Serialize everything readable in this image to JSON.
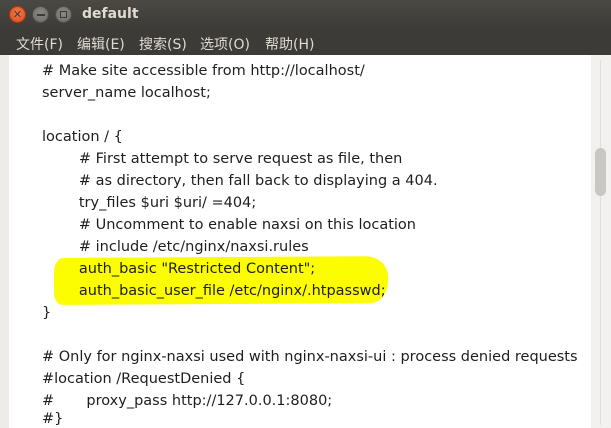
{
  "window": {
    "title": "default"
  },
  "menu": {
    "items": [
      "文件(F)",
      "编辑(E)",
      "搜索(S)",
      "选项(O)",
      "帮助(H)"
    ]
  },
  "editor": {
    "lines": [
      "# Make site accessible from http://localhost/",
      "server_name localhost;",
      "",
      "location / {",
      "        # First attempt to serve request as file, then",
      "        # as directory, then fall back to displaying a 404.",
      "        try_files $uri $uri/ =404;",
      "        # Uncomment to enable naxsi on this location",
      "        # include /etc/nginx/naxsi.rules",
      "        auth_basic \"Restricted Content\";",
      "        auth_basic_user_file /etc/nginx/.htpasswd;",
      "}",
      "",
      "# Only for nginx-naxsi used with nginx-naxsi-ui : process denied requests",
      "#location /RequestDenied {",
      "#       proxy_pass http://127.0.0.1:8080;",
      "#}"
    ]
  },
  "colors": {
    "titlebar": "#3c3b37",
    "highlight": "#fbfd00",
    "close_button": "#df4a16"
  }
}
